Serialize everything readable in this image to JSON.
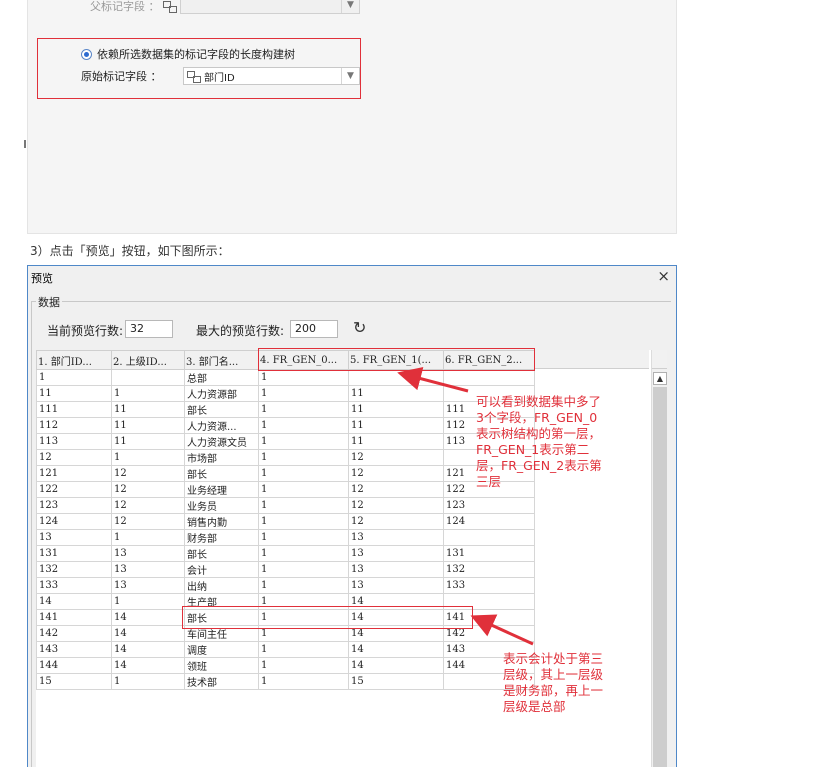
{
  "top_panel": {
    "parent_field_label": "父标记字段 ：",
    "radio_label": "依赖所选数据集的标记字段的长度构建树",
    "original_field_label": "原始标记字段 ：",
    "original_field_value": "部门ID"
  },
  "step_text": "3）点击「预览」按钮，如下图所示：",
  "dialog": {
    "title": "预览",
    "close": "×",
    "group_label": "数据",
    "current_rows_label": "当前预览行数:",
    "current_rows_value": "32",
    "max_rows_label": "最大的预览行数:",
    "max_rows_value": "200",
    "refresh_icon": "↻"
  },
  "table": {
    "headers": [
      "1. 部门ID...",
      "2. 上级ID...",
      "3. 部门名...",
      "4. FR_GEN_0...",
      "5. FR_GEN_1(...",
      "6. FR_GEN_2..."
    ],
    "rows": [
      [
        "1",
        "",
        "总部",
        "1",
        "",
        ""
      ],
      [
        "11",
        "1",
        "人力资源部",
        "1",
        "11",
        ""
      ],
      [
        "111",
        "11",
        "部长",
        "1",
        "11",
        "111"
      ],
      [
        "112",
        "11",
        "人力资源...",
        "1",
        "11",
        "112"
      ],
      [
        "113",
        "11",
        "人力资源文员",
        "1",
        "11",
        "113"
      ],
      [
        "12",
        "1",
        "市场部",
        "1",
        "12",
        ""
      ],
      [
        "121",
        "12",
        "部长",
        "1",
        "12",
        "121"
      ],
      [
        "122",
        "12",
        "业务经理",
        "1",
        "12",
        "122"
      ],
      [
        "123",
        "12",
        "业务员",
        "1",
        "12",
        "123"
      ],
      [
        "124",
        "12",
        "销售内勤",
        "1",
        "12",
        "124"
      ],
      [
        "13",
        "1",
        "财务部",
        "1",
        "13",
        ""
      ],
      [
        "131",
        "13",
        "部长",
        "1",
        "13",
        "131"
      ],
      [
        "132",
        "13",
        "会计",
        "1",
        "13",
        "132"
      ],
      [
        "133",
        "13",
        "出纳",
        "1",
        "13",
        "133"
      ],
      [
        "14",
        "1",
        "生产部",
        "1",
        "14",
        ""
      ],
      [
        "141",
        "14",
        "部长",
        "1",
        "14",
        "141"
      ],
      [
        "142",
        "14",
        "车间主任",
        "1",
        "14",
        "142"
      ],
      [
        "143",
        "14",
        "调度",
        "1",
        "14",
        "143"
      ],
      [
        "144",
        "14",
        "领班",
        "1",
        "14",
        "144"
      ],
      [
        "15",
        "1",
        "技术部",
        "1",
        "15",
        ""
      ]
    ]
  },
  "annotations": {
    "note1": "可以看到数据集中多了\n3个字段，FR_GEN_0\n表示树结构的第一层，\nFR_GEN_1表示第二\n层，FR_GEN_2表示第\n三层",
    "note2": "表示会计处于第三\n层级，其上一层级\n是财务部，再上一\n层级是总部"
  },
  "colors": {
    "annotation_red": "#e0303a",
    "dialog_border": "#4f88c8"
  }
}
